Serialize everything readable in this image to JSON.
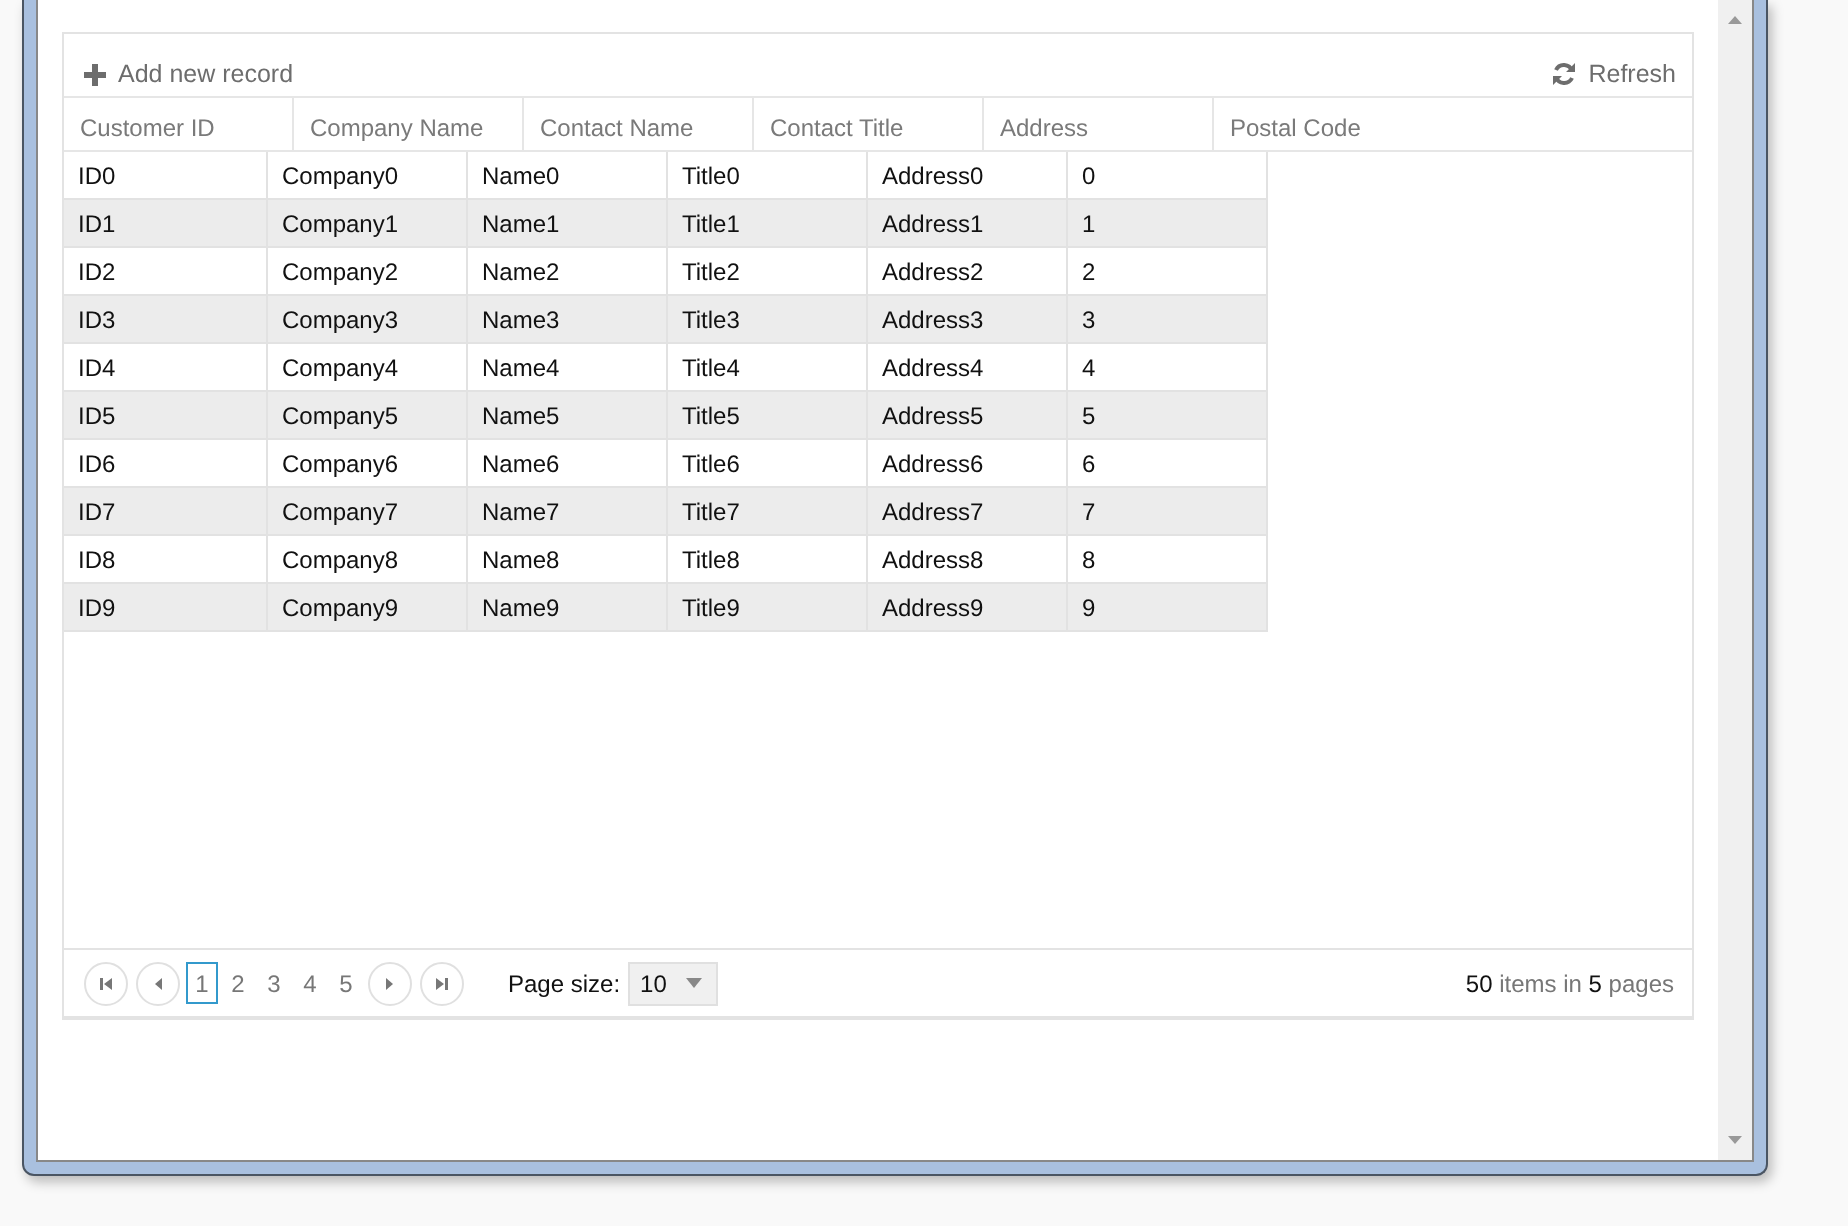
{
  "toolbar": {
    "add_label": "Add new record",
    "refresh_label": "Refresh"
  },
  "columns": [
    "Customer ID",
    "Company Name",
    "Contact Name",
    "Contact Title",
    "Address",
    "Postal Code"
  ],
  "rows": [
    [
      "ID0",
      "Company0",
      "Name0",
      "Title0",
      "Address0",
      "0"
    ],
    [
      "ID1",
      "Company1",
      "Name1",
      "Title1",
      "Address1",
      "1"
    ],
    [
      "ID2",
      "Company2",
      "Name2",
      "Title2",
      "Address2",
      "2"
    ],
    [
      "ID3",
      "Company3",
      "Name3",
      "Title3",
      "Address3",
      "3"
    ],
    [
      "ID4",
      "Company4",
      "Name4",
      "Title4",
      "Address4",
      "4"
    ],
    [
      "ID5",
      "Company5",
      "Name5",
      "Title5",
      "Address5",
      "5"
    ],
    [
      "ID6",
      "Company6",
      "Name6",
      "Title6",
      "Address6",
      "6"
    ],
    [
      "ID7",
      "Company7",
      "Name7",
      "Title7",
      "Address7",
      "7"
    ],
    [
      "ID8",
      "Company8",
      "Name8",
      "Title8",
      "Address8",
      "8"
    ],
    [
      "ID9",
      "Company9",
      "Name9",
      "Title9",
      "Address9",
      "9"
    ]
  ],
  "pager": {
    "pages": [
      {
        "label": "1",
        "selected": true
      },
      {
        "label": "2",
        "selected": false
      },
      {
        "label": "3",
        "selected": false
      },
      {
        "label": "4",
        "selected": false
      },
      {
        "label": "5",
        "selected": false
      }
    ],
    "page_size_label": "Page size:",
    "page_size": "10",
    "summary": "**50** items in **5** pages"
  }
}
